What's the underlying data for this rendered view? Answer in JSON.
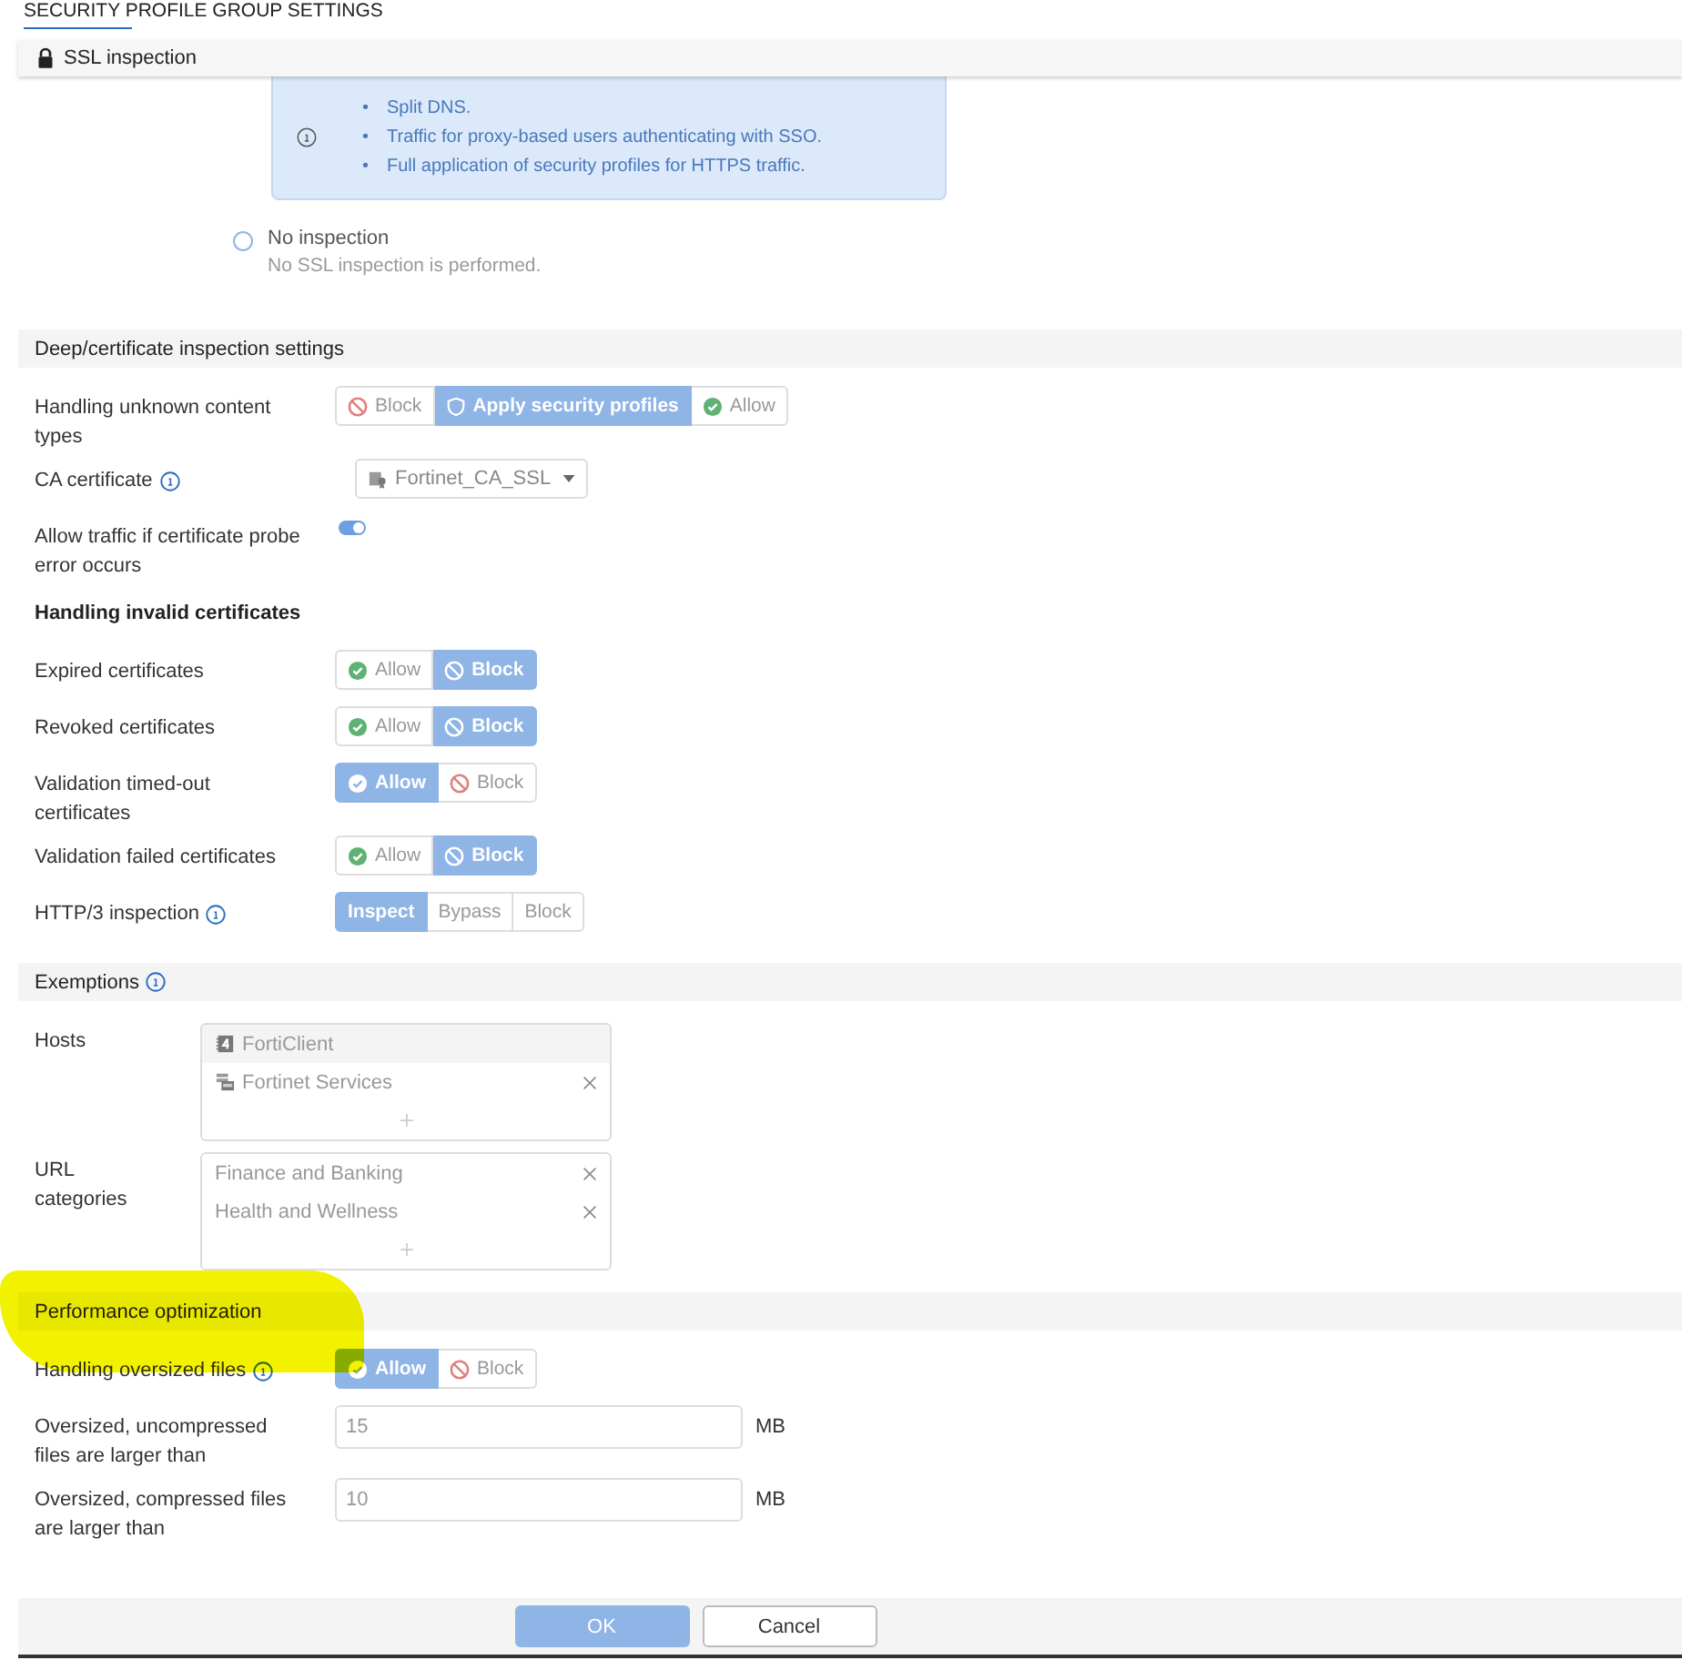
{
  "header": {
    "title": "SECURITY PROFILE GROUP SETTINGS",
    "subtitle": "SSL inspection"
  },
  "info_box": {
    "items": [
      {
        "bullet": "•",
        "text": "Split DNS."
      },
      {
        "bullet": "•",
        "text": "Traffic for proxy-based users authenticating with SSO."
      },
      {
        "bullet": "•",
        "text": "Full application of security profiles for HTTPS traffic."
      }
    ]
  },
  "inspection_option": {
    "label": "No inspection",
    "description": "No SSL inspection is performed.",
    "selected": false
  },
  "sections": [
    {
      "title": "Deep/certificate inspection settings",
      "info": false,
      "highlighted": false,
      "rows": [
        {
          "kind": "segmented",
          "label": "Handling unknown content types",
          "info": false,
          "options": [
            {
              "label": "Block",
              "kind": "block",
              "selected": false
            },
            {
              "label": "Apply security profiles",
              "kind": "shield",
              "selected": true
            },
            {
              "label": "Allow",
              "kind": "allow",
              "selected": false
            }
          ]
        },
        {
          "kind": "select",
          "label": "CA certificate",
          "info": true,
          "value": "Fortinet_CA_SSL"
        },
        {
          "kind": "toggle",
          "label": "Allow traffic if certificate probe error occurs",
          "info": false,
          "on": true
        },
        {
          "kind": "subheading",
          "label": "Handling invalid certificates"
        },
        {
          "kind": "segmented",
          "label": "Expired certificates",
          "info": false,
          "options": [
            {
              "label": "Allow",
              "kind": "allow",
              "selected": false
            },
            {
              "label": "Block",
              "kind": "block",
              "selected": true
            }
          ]
        },
        {
          "kind": "segmented",
          "label": "Revoked certificates",
          "info": false,
          "options": [
            {
              "label": "Allow",
              "kind": "allow",
              "selected": false
            },
            {
              "label": "Block",
              "kind": "block",
              "selected": true
            }
          ]
        },
        {
          "kind": "segmented",
          "label": "Validation timed-out certificates",
          "info": false,
          "options": [
            {
              "label": "Allow",
              "kind": "allow",
              "selected": true
            },
            {
              "label": "Block",
              "kind": "block",
              "selected": false
            }
          ]
        },
        {
          "kind": "segmented",
          "label": "Validation failed certificates",
          "info": false,
          "options": [
            {
              "label": "Allow",
              "kind": "allow",
              "selected": false
            },
            {
              "label": "Block",
              "kind": "block",
              "selected": true
            }
          ]
        },
        {
          "kind": "segmented",
          "label": "HTTP/3 inspection",
          "info": true,
          "options": [
            {
              "label": "Inspect",
              "kind": "plain",
              "selected": true
            },
            {
              "label": "Bypass",
              "kind": "plain",
              "selected": false
            },
            {
              "label": "Block",
              "kind": "plain",
              "selected": false
            }
          ]
        }
      ]
    },
    {
      "title": "Exemptions",
      "info": true,
      "highlighted": false,
      "rows": [
        {
          "kind": "list",
          "label": "Hosts",
          "entries": [
            {
              "text": "FortiClient",
              "kind": "badge",
              "removable": false,
              "hover": true
            },
            {
              "text": "Fortinet Services",
              "kind": "server",
              "removable": true,
              "hover": false
            }
          ]
        },
        {
          "kind": "list",
          "label": "URL categories",
          "entries": [
            {
              "text": "Finance and Banking",
              "kind": "plain",
              "removable": true
            },
            {
              "text": "Health and Wellness",
              "kind": "plain",
              "removable": true
            }
          ]
        }
      ]
    },
    {
      "title": "Performance optimization",
      "info": false,
      "highlighted": true,
      "rows": [
        {
          "kind": "segmented",
          "label": "Handling oversized files",
          "info": true,
          "options": [
            {
              "label": "Allow",
              "kind": "allow",
              "selected": true
            },
            {
              "label": "Block",
              "kind": "block",
              "selected": false
            }
          ]
        },
        {
          "kind": "number",
          "label": "Oversized, uncompressed files are larger than",
          "value": "15",
          "unit": "MB"
        },
        {
          "kind": "number",
          "label": "Oversized, compressed files are larger than",
          "value": "10",
          "unit": "MB"
        }
      ]
    }
  ],
  "buttons": [
    {
      "label": "OK",
      "primary": true
    },
    {
      "label": "Cancel",
      "primary": false
    }
  ]
}
